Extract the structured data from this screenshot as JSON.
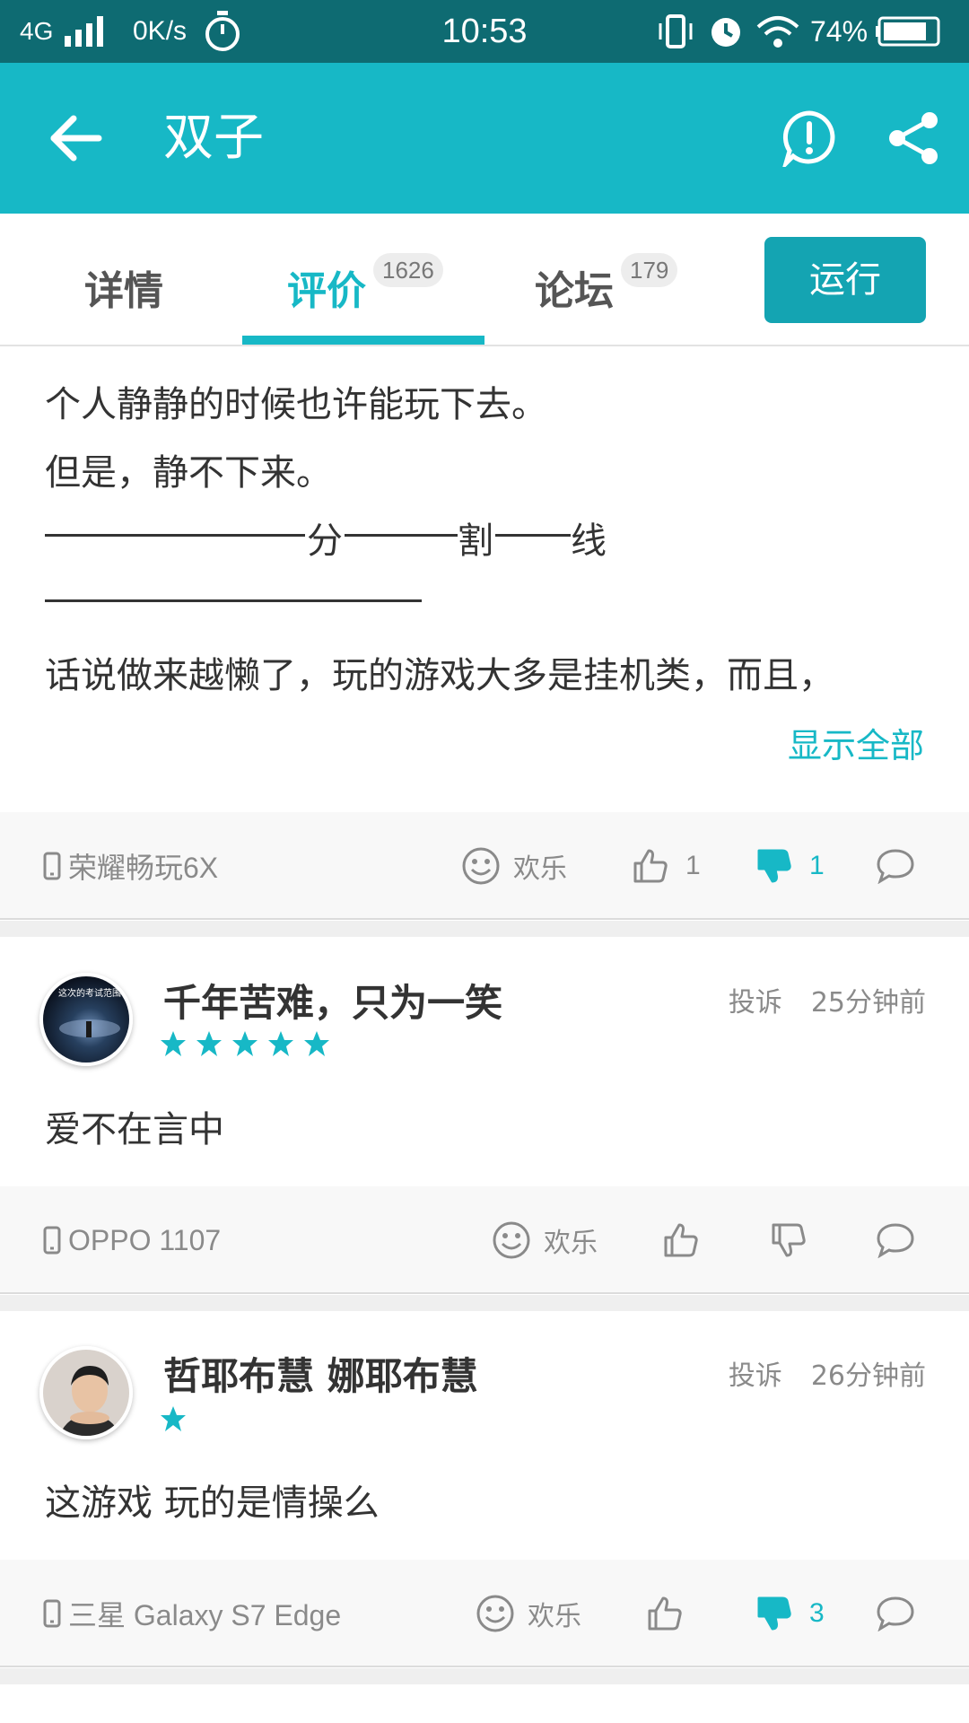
{
  "status_bar": {
    "network": "4G",
    "speed": "0K/s",
    "time": "10:53",
    "battery": "74%"
  },
  "app_bar": {
    "title": "双子",
    "icons": [
      "back-arrow-icon",
      "report-icon",
      "share-icon"
    ]
  },
  "tabs": [
    {
      "label": "详情",
      "count": ""
    },
    {
      "label": "评价",
      "count": "1626"
    },
    {
      "label": "论坛",
      "count": "179"
    }
  ],
  "run_button": "运行",
  "first_review": {
    "lines": [
      "个人静静的时候也许能玩下去。",
      "但是，静不下来。",
      "分",
      "割",
      "线",
      "话说做来越懒了，玩的游戏大多是挂机类，而且，"
    ],
    "show_all": "显示全部",
    "device": "荣耀畅玩6X",
    "mood": "欢乐",
    "likes": "1",
    "dislikes": "1"
  },
  "reviews": [
    {
      "username": "千年苦难，只为一笑",
      "avatar_text": "这次的考试范围",
      "rating": 5,
      "report": "投诉",
      "time": "25分钟前",
      "text": "爱不在言中",
      "device": "OPPO 1107",
      "mood": "欢乐",
      "likes": "",
      "dislikes": ""
    },
    {
      "username": "哲耶布慧 娜耶布慧",
      "avatar_text": "",
      "rating": 1,
      "report": "投诉",
      "time": "26分钟前",
      "text": "这游戏 玩的是情操么",
      "device": "三星 Galaxy S7 Edge",
      "mood": "欢乐",
      "likes": "",
      "dislikes": "3"
    }
  ],
  "colors": {
    "status_bar": "#0e6b72",
    "app_bar": "#17b8c6",
    "accent": "#17b8c6",
    "run_button": "#14a4b2"
  }
}
